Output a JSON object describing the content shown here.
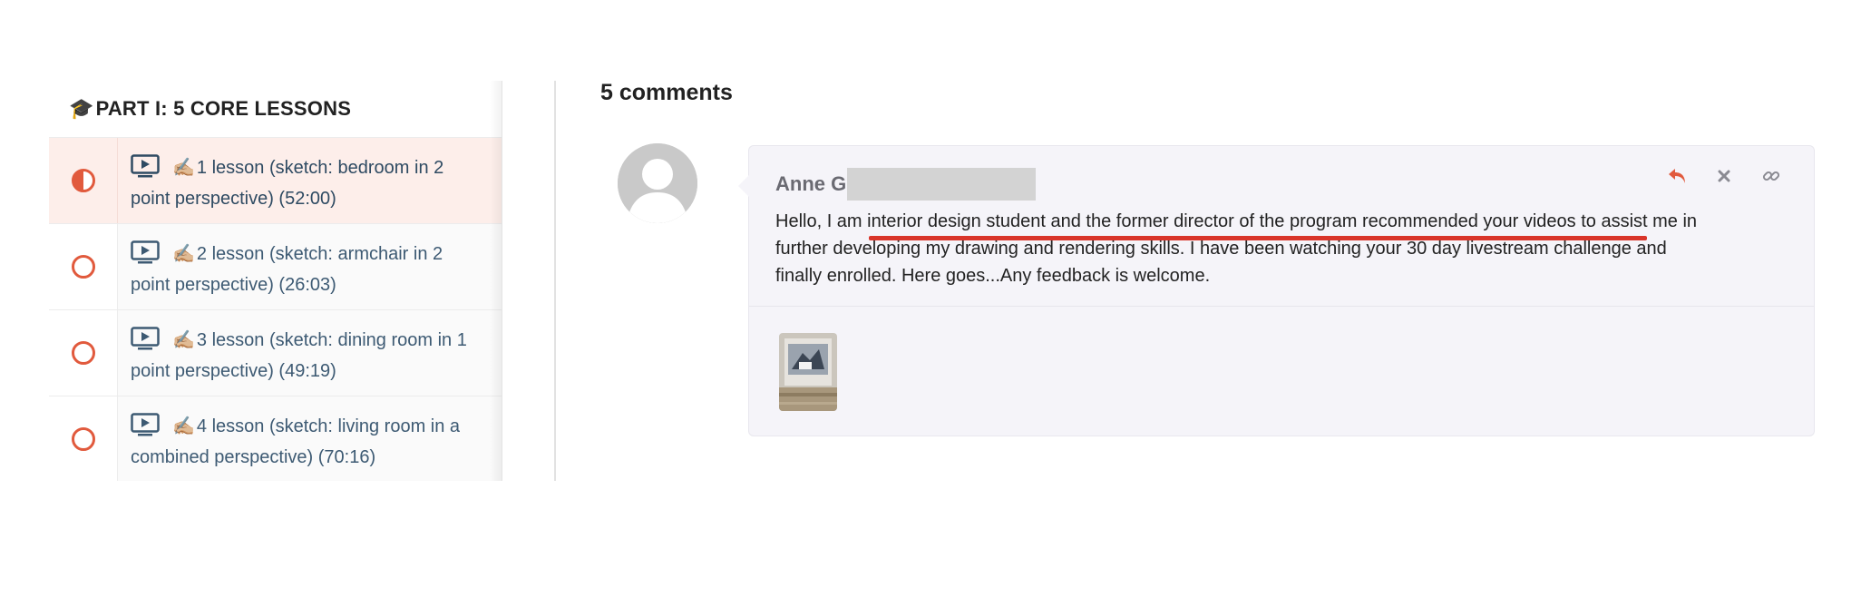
{
  "sidebar": {
    "section_title": "PART I: 5 CORE LESSONS",
    "section_icon": "graduation-cap-icon",
    "lessons": [
      {
        "pen": "✍🏼",
        "label": "1 lesson (sketch: bedroom in 2",
        "label2": "point perspective) (52:00)",
        "status": "in-progress"
      },
      {
        "pen": "✍🏼",
        "label": "2 lesson (sketch: armchair in 2",
        "label2": "point perspective) (26:03)",
        "status": "not-started"
      },
      {
        "pen": "✍🏼",
        "label": "3 lesson (sketch: dining room in 1",
        "label2": "point perspective) (49:19)",
        "status": "not-started"
      },
      {
        "pen": "✍🏼",
        "label": "4 lesson (sketch: living room in a",
        "label2": "combined perspective) (70:16)",
        "status": "not-started"
      }
    ]
  },
  "comments": {
    "count_label": "5 comments",
    "items": [
      {
        "author": "Anne G",
        "line1": "Hello,  I am interior design student and the former director of the program recommended your videos to assist me in",
        "line2": "further developing my drawing and rendering skills.  I have been watching your 30 day livestream challenge and",
        "line3": "finally enrolled.  Here goes...Any feedback is welcome.",
        "actions": [
          "reply-icon",
          "close-icon",
          "link-icon"
        ]
      }
    ]
  },
  "colors": {
    "accent": "#e15a3d",
    "lesson_text": "#3d5a73",
    "active_row": "#fdeeea",
    "card_bg": "#f5f4f9",
    "underline": "#d9352a"
  }
}
